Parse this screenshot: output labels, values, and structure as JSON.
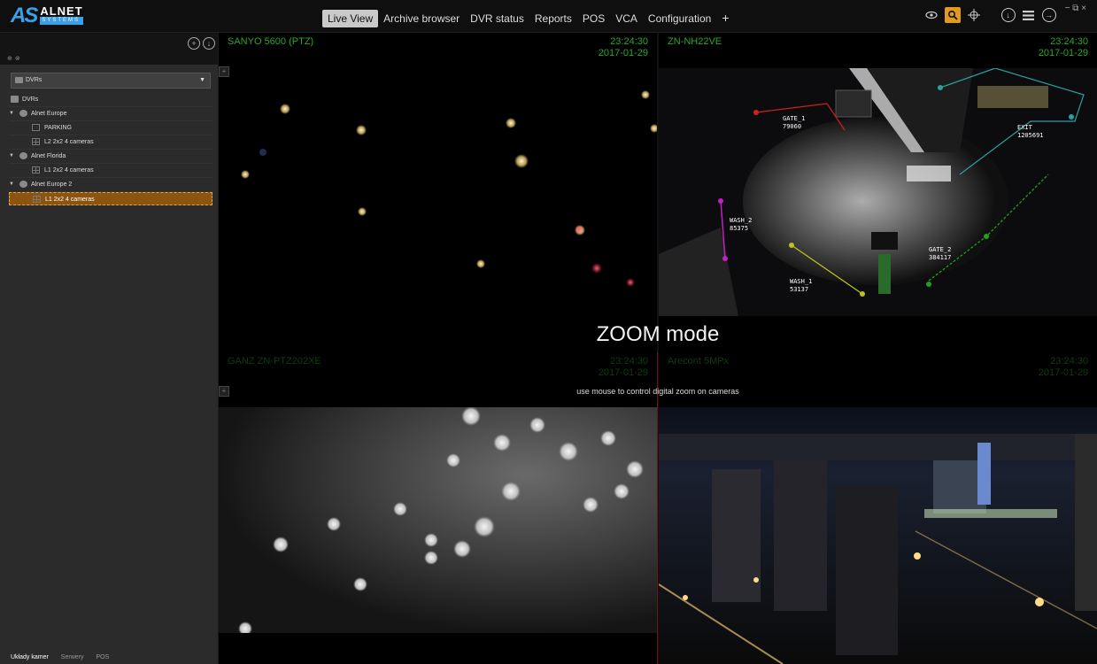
{
  "app": {
    "logo_mark": "AS",
    "logo_text": "ALNET",
    "logo_sub": "SYSTEMS"
  },
  "nav": {
    "tabs": [
      {
        "label": "Live View",
        "active": true
      },
      {
        "label": "Archive browser"
      },
      {
        "label": "DVR status"
      },
      {
        "label": "Reports"
      },
      {
        "label": "POS"
      },
      {
        "label": "VCA"
      },
      {
        "label": "Configuration"
      }
    ],
    "add_tab": "+"
  },
  "toolbar": {
    "icons": [
      "eye-icon",
      "zoom-icon",
      "crosshair-icon",
      "download-icon",
      "menu-icon",
      "exit-icon"
    ],
    "active_color": "#e29a1c"
  },
  "sidebar": {
    "selector_value": "DVRs",
    "tree": [
      {
        "label": "DVRs",
        "icon": "folder-icon",
        "level": 0
      },
      {
        "label": "Alnet Europe",
        "icon": "globe-icon",
        "level": 0,
        "expanded": true
      },
      {
        "label": "PARKING",
        "icon": "layout-single-icon",
        "level": 1
      },
      {
        "label": "L2 2x2 4 cameras",
        "icon": "layout-grid-icon",
        "level": 1
      },
      {
        "label": "Alnet Florida",
        "icon": "globe-icon",
        "level": 0,
        "expanded": true
      },
      {
        "label": "L1 2x2 4 cameras",
        "icon": "layout-grid-icon",
        "level": 1
      },
      {
        "label": "Alnet Europe 2",
        "icon": "globe-icon",
        "level": 0,
        "expanded": true
      },
      {
        "label": "L1 2x2 4 cameras",
        "icon": "layout-grid-icon",
        "level": 1,
        "selected": true
      }
    ],
    "bottom_tabs": [
      {
        "label": "Układy kamer",
        "active": true
      },
      {
        "label": "Serwery"
      },
      {
        "label": "POS"
      }
    ]
  },
  "cameras": [
    {
      "name": "SANYO 5600 (PTZ)",
      "time": "23:24:30",
      "date": "2017-01-29"
    },
    {
      "name": "ZN-NH22VE",
      "time": "23:24:30",
      "date": "2017-01-29"
    },
    {
      "name": "GANZ ZN-PTZ202XE",
      "time": "23:24:30",
      "date": "2017-01-29"
    },
    {
      "name": "Arecont 5MPx",
      "time": "23:24:30",
      "date": "2017-01-29"
    }
  ],
  "vca_zones": [
    {
      "label": "GATE_1",
      "count": "79060"
    },
    {
      "label": "EXIT",
      "count": "1205691"
    },
    {
      "label": "WASH_2",
      "count": "85375"
    },
    {
      "label": "GATE_2",
      "count": "384117"
    },
    {
      "label": "WASH_1",
      "count": "53137"
    }
  ],
  "zoom_overlay": {
    "title": "ZOOM mode",
    "subtitle": "use mouse to control digital zoom on cameras"
  }
}
